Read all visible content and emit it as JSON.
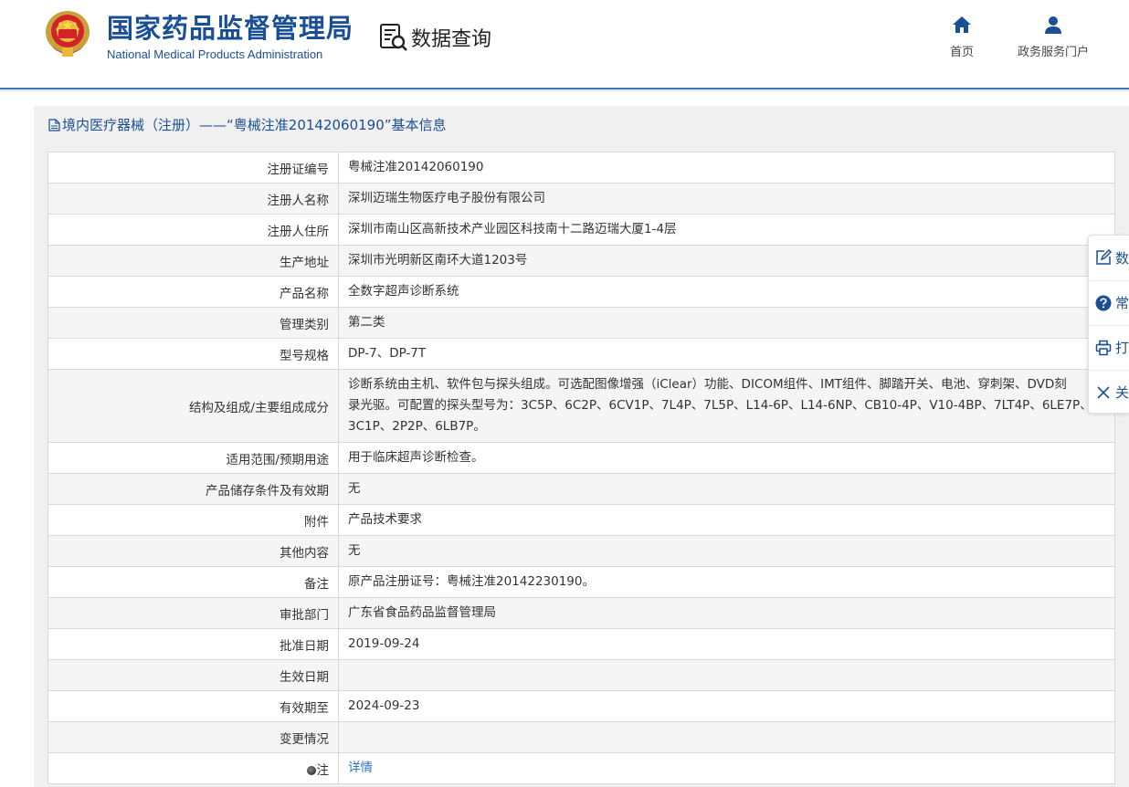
{
  "header": {
    "agency_cn": "国家药品监督管理局",
    "agency_en": "National Medical Products Administration",
    "query_title": "数据查询",
    "nav": [
      {
        "label": "首页",
        "icon": "home-icon"
      },
      {
        "label": "政务服务门户",
        "icon": "user-icon"
      }
    ]
  },
  "page": {
    "title": "境内医疗器械（注册）——“粤械注准20142060190”基本信息"
  },
  "rows": [
    {
      "label": "注册证编号",
      "value": "粤械注准20142060190"
    },
    {
      "label": "注册人名称",
      "value": "深圳迈瑞生物医疗电子股份有限公司"
    },
    {
      "label": "注册人住所",
      "value": "深圳市南山区高新技术产业园区科技南十二路迈瑞大厦1-4层"
    },
    {
      "label": "生产地址",
      "value": "深圳市光明新区南环大道1203号"
    },
    {
      "label": "产品名称",
      "value": "全数字超声诊断系统"
    },
    {
      "label": "管理类别",
      "value": "第二类"
    },
    {
      "label": "型号规格",
      "value": "DP-7、DP-7T"
    },
    {
      "label": "结构及组成/主要组成成分",
      "value_lines": [
        "诊断系统由主机、软件包与探头组成。可选配图像增强（iClear）功能、DICOM组件、IMT组件、脚踏开关、电池、穿刺架、DVD刻",
        "录光驱。可配置的探头型号为：3C5P、6C2P、6CV1P、7L4P、7L5P、L14-6P、L14-6NP、CB10-4P、V10-4BP、7LT4P、6LE7P、",
        "3C1P、2P2P、6LB7P。"
      ]
    },
    {
      "label": "适用范围/预期用途",
      "value": "用于临床超声诊断检查。"
    },
    {
      "label": "产品储存条件及有效期",
      "value": "无"
    },
    {
      "label": "附件",
      "value": "产品技术要求"
    },
    {
      "label": "其他内容",
      "value": "无"
    },
    {
      "label": "备注",
      "value": "原产品注册证号：粤械注准20142230190。"
    },
    {
      "label": "审批部门",
      "value": "广东省食品药品监督管理局"
    },
    {
      "label": "批准日期",
      "value": "2019-09-24"
    },
    {
      "label": "生效日期",
      "value": ""
    },
    {
      "label": "有效期至",
      "value": "2024-09-23"
    },
    {
      "label": "变更情况",
      "value": ""
    },
    {
      "label": "注",
      "value": "详情"
    }
  ],
  "sidebar": [
    {
      "label": "数",
      "icon": "edit-icon"
    },
    {
      "label": "常",
      "icon": "help-icon"
    },
    {
      "label": "打",
      "icon": "print-icon"
    },
    {
      "label": "关",
      "icon": "close-icon"
    }
  ],
  "colors": {
    "brand": "#1a4f96",
    "link": "#2a72c9",
    "header_rule": "#3b78b9"
  }
}
